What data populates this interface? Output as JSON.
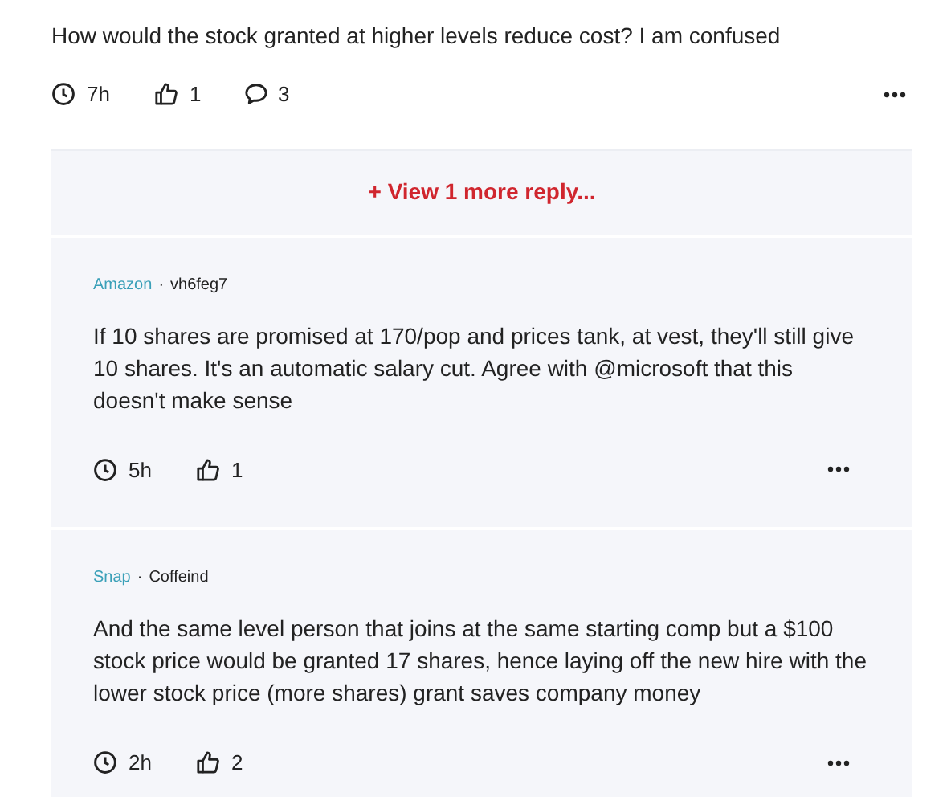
{
  "post": {
    "text": "How would the stock granted at higher levels reduce cost? I am confused",
    "time": "7h",
    "likes": "1",
    "comments": "3"
  },
  "more_replies": "+ View 1 more reply...",
  "replies": [
    {
      "company": "Amazon",
      "separator": "·",
      "user": "vh6feg7",
      "text": "If 10 shares are promised at 170/pop and prices tank, at vest, they'll still give 10 shares. It's an automatic salary cut. Agree with @microsoft that this doesn't make sense",
      "time": "5h",
      "likes": "1"
    },
    {
      "company": "Snap",
      "separator": "·",
      "user": "Coffeind",
      "text": "And the same level person that joins at the same starting comp but a $100 stock price would be granted 17 shares, hence laying off the new hire with the lower stock price (more shares) grant saves company money",
      "time": "2h",
      "likes": "2"
    }
  ]
}
